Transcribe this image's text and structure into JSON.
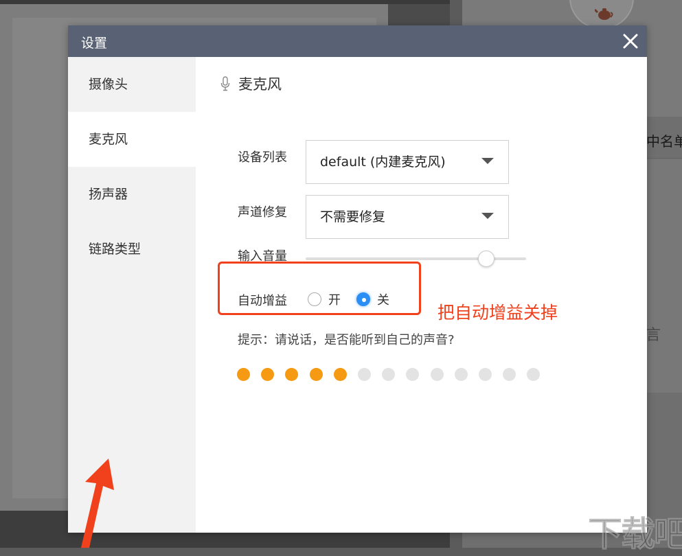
{
  "dialog": {
    "title": "设置"
  },
  "sidebar": {
    "items": [
      {
        "label": "摄像头",
        "active": false
      },
      {
        "label": "麦克风",
        "active": true
      },
      {
        "label": "扬声器",
        "active": false
      },
      {
        "label": "链路类型",
        "active": false
      }
    ]
  },
  "content": {
    "section_title": "麦克风",
    "device_list": {
      "label": "设备列表",
      "value": "default (内建麦克风)"
    },
    "channel_repair": {
      "label": "声道修复",
      "value": "不需要修复"
    },
    "input_volume": {
      "label": "输入音量",
      "level_percent": 84
    },
    "auto_gain": {
      "label": "自动增益",
      "options": [
        {
          "label": "开",
          "checked": false
        },
        {
          "label": "关",
          "checked": true
        }
      ]
    },
    "hint": "提示：请说话，是否能听到自己的声音?",
    "level_meter": {
      "total": 13,
      "active": 5,
      "active_color": "#f59a12",
      "inactive_color": "#e3e3e3"
    }
  },
  "annotation": {
    "text": "把自动增益关掉",
    "color": "#f0401c"
  },
  "background": {
    "right_text_1": "中名单",
    "right_text_2": "言"
  },
  "watermark": "下载吧"
}
